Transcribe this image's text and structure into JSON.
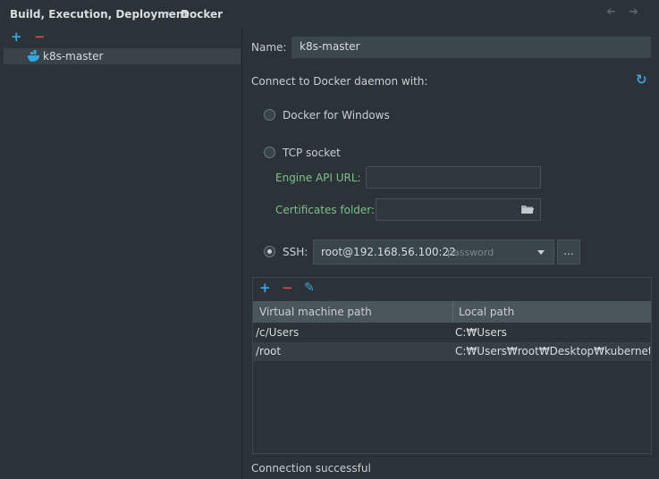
{
  "breadcrumb": {
    "part1": "Build, Execution, Deployment",
    "separator": "›",
    "part2": "Docker"
  },
  "nav": {
    "back": "➔",
    "forward": "➔"
  },
  "left": {
    "add": "+",
    "remove": "−",
    "items": [
      {
        "label": "k8s-master"
      }
    ]
  },
  "form": {
    "name_label": "Name:",
    "name_value": "k8s-master",
    "connect_label": "Connect to Docker daemon with:",
    "refresh_icon": "↻",
    "options": {
      "windows": "Docker for Windows",
      "tcp": "TCP socket",
      "engine_url_label": "Engine API URL:",
      "cert_label": "Certificates folder:",
      "ssh": "SSH:",
      "ssh_host": "root@192.168.56.100:22",
      "ssh_auth": "password",
      "browse": "..."
    },
    "selected": "ssh"
  },
  "mappings": {
    "add": "+",
    "remove": "−",
    "edit": "✎",
    "columns": [
      "Virtual machine path",
      "Local path"
    ],
    "rows": [
      {
        "vm": "/c/Users",
        "local": "C:₩Users"
      },
      {
        "vm": "/root",
        "local": "C:₩Users₩root₩Desktop₩kubernetes_..."
      }
    ]
  },
  "status": "Connection successful",
  "colors": {
    "accent": "#3aa3d8",
    "danger": "#d24b4b",
    "label_green": "#7fbf8a"
  }
}
